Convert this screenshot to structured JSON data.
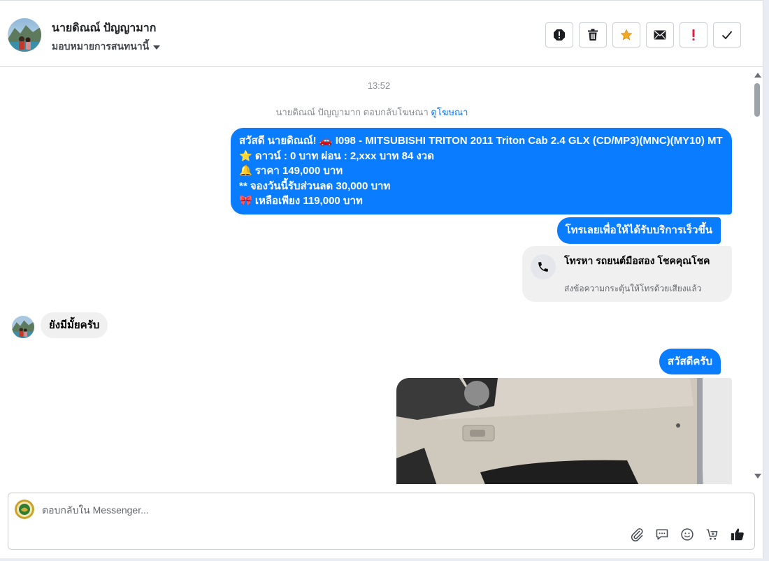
{
  "header": {
    "name": "นายดิณณ์ ปัญญามาก",
    "assign_label": "มอบหมายการสนทนานี้"
  },
  "actions": [
    {
      "name": "spam-icon"
    },
    {
      "name": "trash-icon"
    },
    {
      "name": "star-icon"
    },
    {
      "name": "envelope-icon"
    },
    {
      "name": "exclamation-icon"
    },
    {
      "name": "checkmark-icon"
    }
  ],
  "thread": {
    "timestamp": "13:52",
    "ad_note_text": "นายดิณณ์ ปัญญามาก ตอบกลับโฆษณา",
    "ad_note_link": "ดูโฆษณา",
    "msg1_lines": [
      "สวัสดี นายดิณณ์! 🚗 I098 - MITSUBISHI TRITON 2011 Triton Cab 2.4 GLX (CD/MP3)(MNC)(MY10) MT",
      "⭐ ดาวน์ : 0 บาท ผ่อน : 2,xxx บาท 84 งวด",
      "🔔  ราคา 149,000 บาท",
      "** จองวันนี้รับส่วนลด 30,000 บาท",
      "🎀 เหลือเพียง 119,000 บาท"
    ],
    "msg2": "โทรเลยเพื่อให้ได้รับบริการเร็วขึ้น",
    "call_title": "โทรหา รถยนต์มือสอง โชคคุณโชค",
    "call_subtitle": "ส่งข้อความกระตุ้นให้โทรด้วยเสียงแล้ว",
    "incoming": "ยังมีมั้ยครับ",
    "msg3": "สวัสดีครับ"
  },
  "composer": {
    "placeholder": "ตอบกลับใน Messenger..."
  },
  "colors": {
    "outgoing": "#0a7cff",
    "incoming": "#f0f0f0",
    "star": "#f5a623",
    "alert": "#e41e3f"
  }
}
